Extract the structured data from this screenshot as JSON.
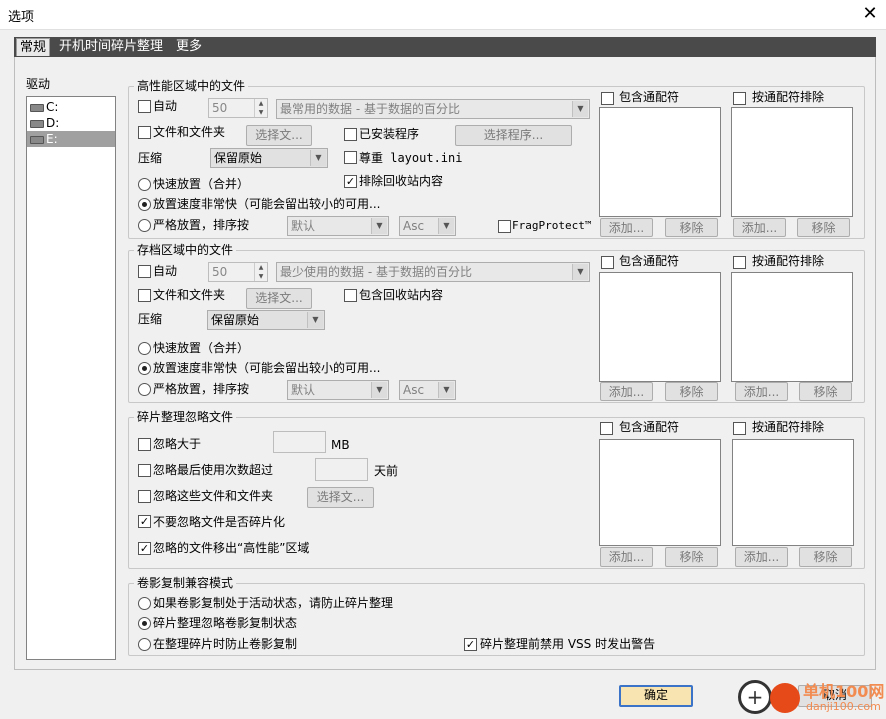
{
  "window": {
    "title": "选项",
    "close": "✕"
  },
  "tabs": [
    "常规",
    "开机时间碎片整理",
    "更多"
  ],
  "drives": {
    "title": "驱动",
    "items": [
      "C:",
      "D:",
      "E:"
    ],
    "selected": "E:"
  },
  "performance": {
    "title": "高性能区域中的文件",
    "auto_label": "自动",
    "auto_checked": false,
    "auto_value": "50",
    "auto_dropdown": "最常用的数据 - 基于数据的百分比",
    "files_folders_label": "文件和文件夹",
    "files_folders_checked": false,
    "select_files": "选择文...",
    "installed_programs_label": "已安装程序",
    "installed_programs_checked": false,
    "select_programs": "选择程序...",
    "compress_label": "压缩",
    "compress_value": "保留原始",
    "respect_layout_label": "尊重 layout.ini",
    "respect_layout_checked": false,
    "exclude_recycle_label": "排除回收站内容",
    "exclude_recycle_checked": true,
    "radio_fast": "快速放置（合并）",
    "radio_veryfast": "放置速度非常快（可能会留出较小的可用...",
    "radio_strict": "严格放置，排序按",
    "selected_radio": "veryfast",
    "sort_value": "默认",
    "order_value": "Asc",
    "fragprotect_label": "FragProtect™",
    "fragprotect_checked": false,
    "include_wildcard": "包含通配符",
    "exclude_wildcard": "按通配符排除",
    "add": "添加...",
    "remove": "移除"
  },
  "archive": {
    "title": "存档区域中的文件",
    "auto_label": "自动",
    "auto_checked": false,
    "auto_value": "50",
    "auto_dropdown": "最少使用的数据 - 基于数据的百分比",
    "files_folders_label": "文件和文件夹",
    "files_folders_checked": false,
    "select_files": "选择文...",
    "include_recycle_label": "包含回收站内容",
    "include_recycle_checked": false,
    "compress_label": "压缩",
    "compress_value": "保留原始",
    "radio_fast": "快速放置（合并）",
    "radio_veryfast": "放置速度非常快（可能会留出较小的可用...",
    "radio_strict": "严格放置，排序按",
    "selected_radio": "veryfast",
    "sort_value": "默认",
    "order_value": "Asc",
    "include_wildcard": "包含通配符",
    "exclude_wildcard": "按通配符排除",
    "add": "添加...",
    "remove": "移除"
  },
  "ignore": {
    "title": "碎片整理忽略文件",
    "larger_label": "忽略大于",
    "larger_checked": false,
    "larger_unit": "MB",
    "larger_value": "",
    "lastused_label": "忽略最后使用次数超过",
    "lastused_checked": false,
    "lastused_unit": "天前",
    "lastused_value": "",
    "these_files_label": "忽略这些文件和文件夹",
    "these_files_checked": false,
    "select_files": "选择文...",
    "dont_ignore_frag_label": "不要忽略文件是否碎片化",
    "dont_ignore_frag_checked": true,
    "move_out_label": "忽略的文件移出“高性能”区域",
    "move_out_checked": true,
    "include_wildcard": "包含通配符",
    "exclude_wildcard": "按通配符排除",
    "add": "添加...",
    "remove": "移除"
  },
  "vss": {
    "title": "卷影复制兼容模式",
    "opt1": "如果卷影复制处于活动状态，请防止碎片整理",
    "opt2": "碎片整理忽略卷影复制状态",
    "opt3": "在整理碎片时防止卷影复制",
    "selected": "opt2",
    "disable_vss_label": "碎片整理前禁用 VSS 时发出警告",
    "disable_vss_checked": true
  },
  "footer": {
    "ok": "确定",
    "cancel": "取消"
  },
  "watermark": {
    "text": "单机100网",
    "url": "danji100.com"
  }
}
